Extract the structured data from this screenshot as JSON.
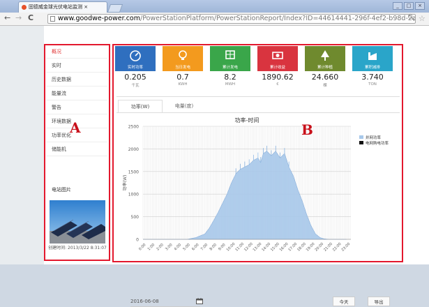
{
  "browser": {
    "tab_title": "固德威金球光伏电站监测 ×",
    "url_domain": "www.goodwe-power.com",
    "url_path": "/PowerStationPlatform/PowerStationReport/Index?ID=44614441-296f-4ef2-b98d-2ac53b558",
    "back": "←",
    "forward": "→",
    "reload": "C",
    "window_controls": [
      "_",
      "□",
      "×"
    ]
  },
  "sidebar": {
    "items": [
      {
        "label": "概况",
        "active": true
      },
      {
        "label": "实时"
      },
      {
        "label": "历史数据"
      },
      {
        "label": "能量流"
      },
      {
        "label": "警告"
      },
      {
        "label": "环境数据"
      },
      {
        "label": "功率优化"
      },
      {
        "label": "储能机"
      }
    ],
    "photo_title": "电站图片",
    "photo_caption": "创建时间: 2013/3/22 8:31:07"
  },
  "kpis": [
    {
      "label": "实时功率",
      "value": "0.205",
      "unit": "千瓦",
      "color": "#2f6fbf",
      "icon": "speedometer-icon"
    },
    {
      "label": "当日发电",
      "value": "0.7",
      "unit": "KWH",
      "color": "#f39a1e",
      "icon": "lightbulb-icon"
    },
    {
      "label": "累计发电",
      "value": "8.2",
      "unit": "MWH",
      "color": "#3aa64a",
      "icon": "panel-icon"
    },
    {
      "label": "累计收益",
      "value": "1890.62",
      "unit": "€",
      "color": "#d9343f",
      "icon": "money-icon"
    },
    {
      "label": "累计种植",
      "value": "24.660",
      "unit": "棵",
      "color": "#6f8a2e",
      "icon": "tree-icon"
    },
    {
      "label": "累积减排",
      "value": "3.740",
      "unit": "TON",
      "color": "#2aa5c9",
      "icon": "factory-icon"
    }
  ],
  "chart_tabs": [
    {
      "label": "功率(W)",
      "active": true
    },
    {
      "label": "电量(度)"
    }
  ],
  "chart_data": {
    "type": "area",
    "title": "功率-时间",
    "ylabel": "功率(W)",
    "xlabel": "",
    "ylim": [
      0,
      2500
    ],
    "yticks": [
      0,
      500,
      1000,
      1500,
      2000,
      2500
    ],
    "x_tick_labels": [
      "0:00",
      "1:00",
      "2:00",
      "3:00",
      "4:00",
      "5:00",
      "6:00",
      "7:00",
      "8:00",
      "9:00",
      "10:00",
      "11:00",
      "12:00",
      "13:00",
      "14:00",
      "15:00",
      "16:00",
      "17:00",
      "18:00",
      "19:00",
      "20:00",
      "21:00",
      "22:00",
      "23:00"
    ],
    "x": [
      0,
      1,
      2,
      3,
      4,
      5,
      5.5,
      6,
      6.5,
      7,
      7.5,
      8,
      8.5,
      9,
      9.5,
      10,
      10.5,
      11,
      11.5,
      12,
      12.5,
      13,
      13.3,
      13.6,
      14,
      14.5,
      15,
      15.5,
      16,
      16.5,
      17,
      17.5,
      18,
      18.5,
      19,
      19.5,
      20,
      20.5,
      21,
      22,
      23
    ],
    "series": [
      {
        "name": "并网功率",
        "color": "#a8c8ea",
        "values": [
          0,
          0,
          0,
          0,
          0,
          0,
          20,
          40,
          80,
          120,
          250,
          420,
          600,
          800,
          1000,
          1250,
          1450,
          1550,
          1600,
          1650,
          1750,
          1800,
          1700,
          1900,
          1950,
          1850,
          1950,
          1800,
          1900,
          1600,
          1400,
          1100,
          850,
          550,
          300,
          120,
          40,
          10,
          0,
          0,
          0
        ]
      },
      {
        "name": "电网购电功率",
        "color": "#111111",
        "values": []
      }
    ],
    "grid": true,
    "legend_position": "top-right"
  },
  "footer": {
    "date_value": "2016-06-08",
    "today_button": "今天",
    "export_button": "导出"
  },
  "annotations": {
    "label_a": "A",
    "label_b": "B",
    "box_color": "#e3182d"
  }
}
